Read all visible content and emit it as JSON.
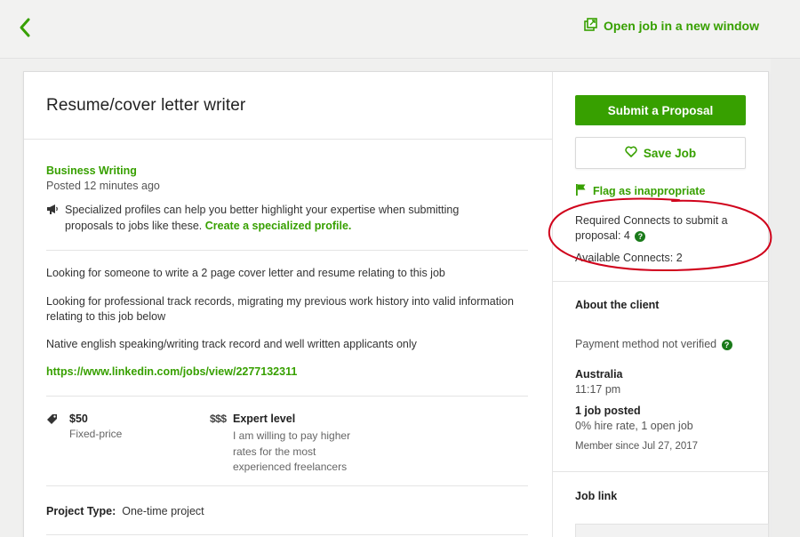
{
  "header": {
    "open_window_label": "Open job in a new window"
  },
  "job": {
    "title": "Resume/cover letter writer",
    "category": "Business Writing",
    "posted": "Posted 12 minutes ago",
    "promo_text": "Specialized profiles can help you better highlight your expertise when submitting proposals to jobs like these.",
    "promo_link": "Create a specialized profile.",
    "description": [
      "Looking for someone to write a 2 page cover letter and resume relating to this job",
      "Looking for professional track records, migrating my previous work history into valid information relating to this job below",
      "Native english speaking/writing track record and well written applicants only"
    ],
    "link": "https://www.linkedin.com/jobs/view/2277132311",
    "price": "$50",
    "price_type": "Fixed-price",
    "level_sign": "$$$",
    "level": "Expert level",
    "level_desc": "I am willing to pay higher rates for the most experienced freelancers",
    "project_type_label": "Project Type:",
    "project_type": "One-time project"
  },
  "sidebar": {
    "submit_label": "Submit a Proposal",
    "save_label": "Save Job",
    "flag_label": "Flag as inappropriate",
    "connects_required": "Required Connects to submit a proposal: 4",
    "connects_available": "Available Connects: 2",
    "about_title": "About the client",
    "payment": "Payment method not verified",
    "country": "Australia",
    "local_time": "11:17 pm",
    "jobs_posted": "1 job posted",
    "hire_rate": "0% hire rate, 1 open job",
    "member_since": "Member since Jul 27, 2017",
    "job_link_title": "Job link",
    "help_glyph": "?"
  },
  "colors": {
    "accent": "#37a000",
    "annotation": "#d0021b"
  },
  "icons": [
    "back-arrow-icon",
    "external-window-icon",
    "megaphone-icon",
    "tag-icon",
    "heart-icon",
    "flag-icon",
    "help-icon"
  ]
}
